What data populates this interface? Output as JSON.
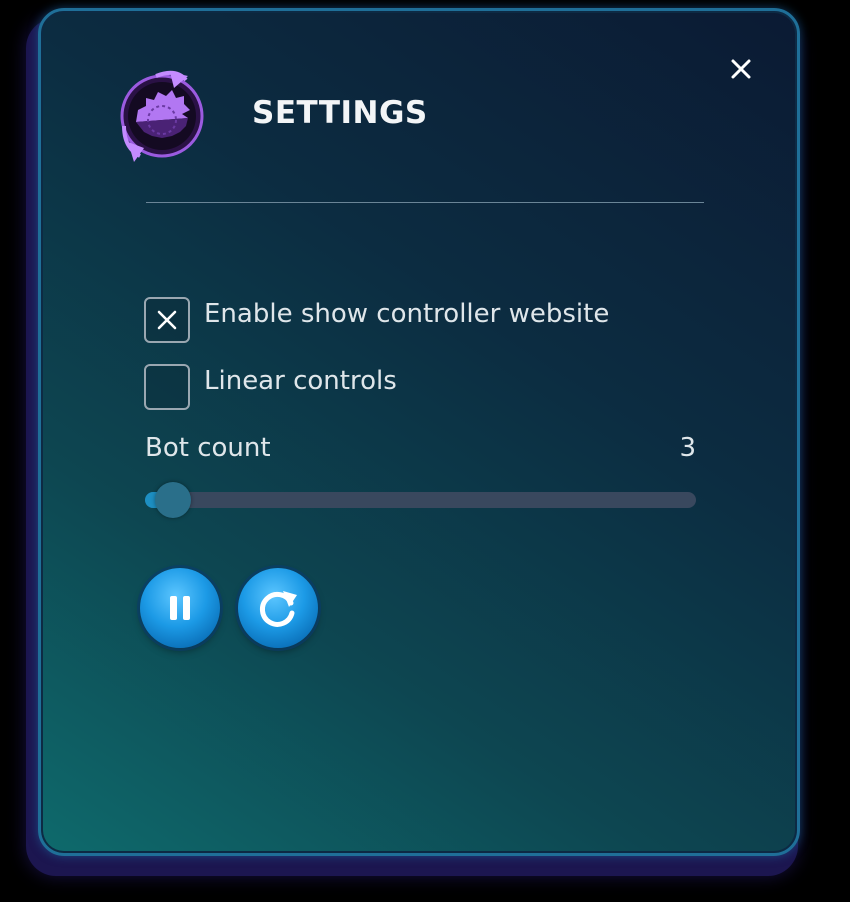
{
  "dialog": {
    "title": "SETTINGS",
    "close_icon": "close-icon",
    "logo_icon": "gear-cycle-logo"
  },
  "options": {
    "show_controller": {
      "label": "Enable show controller website",
      "checked": true
    },
    "linear_controls": {
      "label": "Linear controls",
      "checked": false
    }
  },
  "bot_count": {
    "label": "Bot count",
    "value": "3",
    "slider_fraction": 0.05
  },
  "controls": {
    "pause_icon": "pause-icon",
    "restart_icon": "restart-icon"
  },
  "colors": {
    "accent": "#1d8fc2",
    "logo_purple": "#a25ee8",
    "text": "#dfe6ea"
  }
}
